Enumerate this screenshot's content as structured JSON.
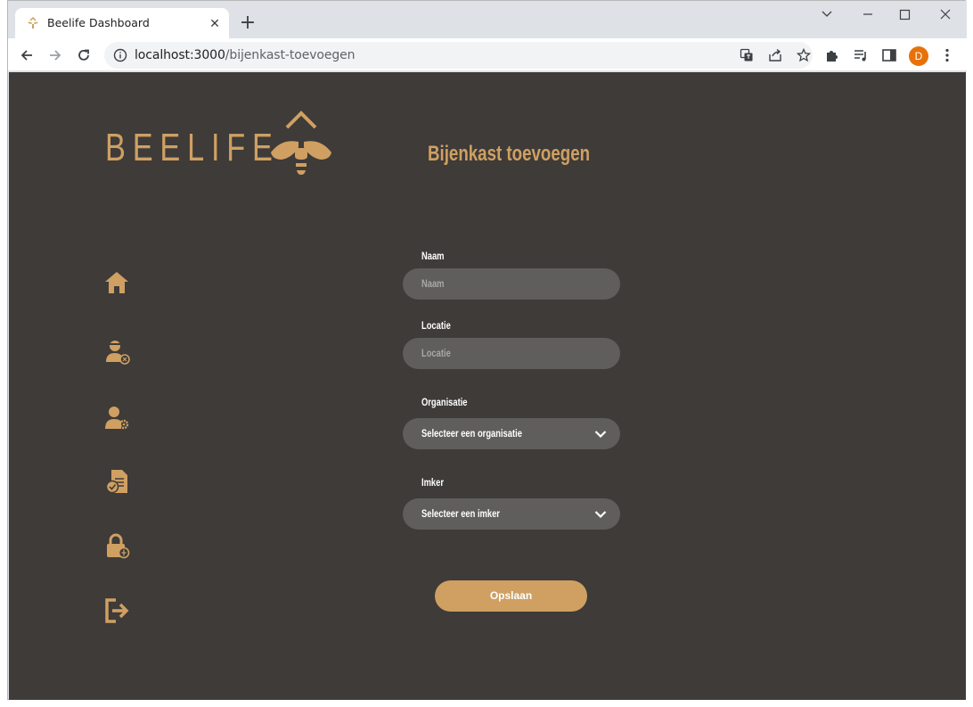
{
  "browser": {
    "tab_title": "Beelife Dashboard",
    "tab_close": "✕",
    "new_tab": "+",
    "url_host": "localhost:3000",
    "url_path": "/bijenkast-toevoegen",
    "profile_initial": "D",
    "profile_color": "#e8710a"
  },
  "app": {
    "logo_text": "BEELIFE",
    "accent_color": "#cfa062",
    "background_color": "#3e3b39",
    "page_title": "Bijenkast toevoegen"
  },
  "sidebar": {
    "items": [
      {
        "name": "home-icon"
      },
      {
        "name": "beekeeper-icon"
      },
      {
        "name": "user-settings-icon"
      },
      {
        "name": "document-check-icon"
      },
      {
        "name": "lock-icon"
      },
      {
        "name": "logout-icon"
      }
    ]
  },
  "form": {
    "naam_label": "Naam",
    "naam_placeholder": "Naam",
    "locatie_label": "Locatie",
    "locatie_placeholder": "Locatie",
    "organisatie_label": "Organisatie",
    "organisatie_selected": "Selecteer een organisatie",
    "imker_label": "Imker",
    "imker_selected": "Selecteer een imker",
    "save_label": "Opslaan"
  }
}
